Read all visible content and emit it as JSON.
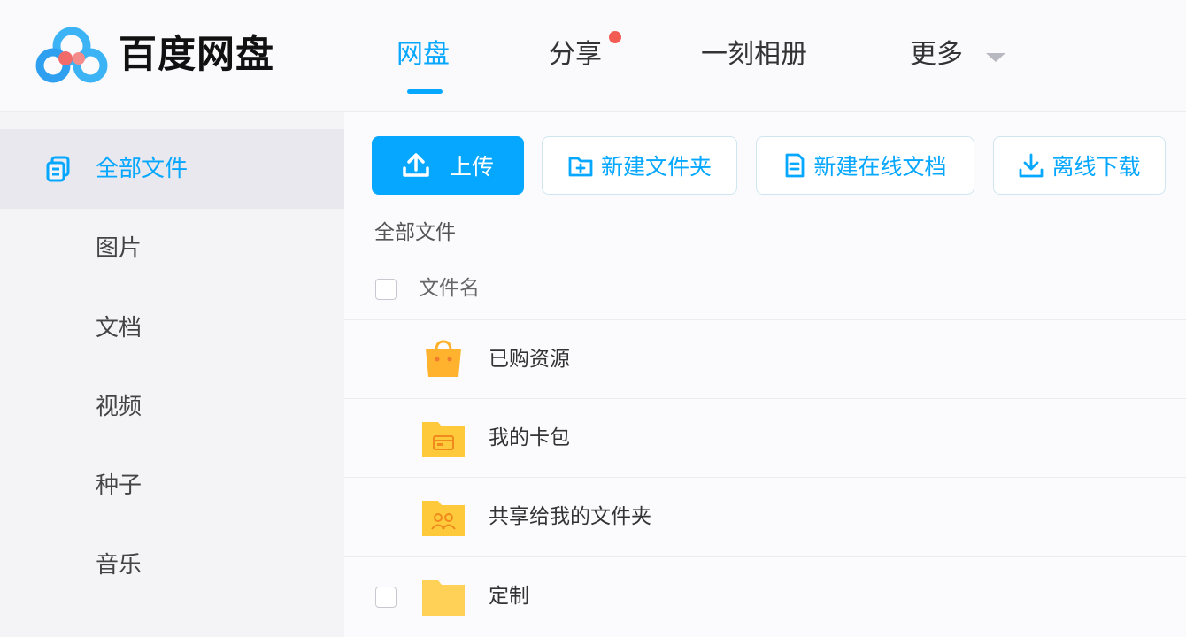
{
  "header": {
    "brand": "百度网盘",
    "nav": [
      {
        "label": "网盘",
        "active": true
      },
      {
        "label": "分享",
        "active": false,
        "badge": true
      },
      {
        "label": "一刻相册",
        "active": false
      },
      {
        "label": "更多",
        "active": false,
        "dropdown": true
      }
    ]
  },
  "sidebar": {
    "items": [
      {
        "label": "全部文件",
        "active": true,
        "icon": "files-icon"
      },
      {
        "label": "图片"
      },
      {
        "label": "文档"
      },
      {
        "label": "视频"
      },
      {
        "label": "种子"
      },
      {
        "label": "音乐"
      }
    ]
  },
  "toolbar": {
    "upload": "上传",
    "new_folder": "新建文件夹",
    "new_doc": "新建在线文档",
    "offline_download": "离线下载"
  },
  "breadcrumb": "全部文件",
  "table": {
    "column_name": "文件名",
    "rows": [
      {
        "name": "已购资源",
        "icon": "shopping-bag-icon"
      },
      {
        "name": "我的卡包",
        "icon": "card-folder-icon"
      },
      {
        "name": "共享给我的文件夹",
        "icon": "shared-folder-icon"
      },
      {
        "name": "定制",
        "icon": "folder-icon"
      }
    ]
  },
  "colors": {
    "accent": "#06a7ff",
    "badge": "#f25c53",
    "folder": "#ffc93c"
  }
}
